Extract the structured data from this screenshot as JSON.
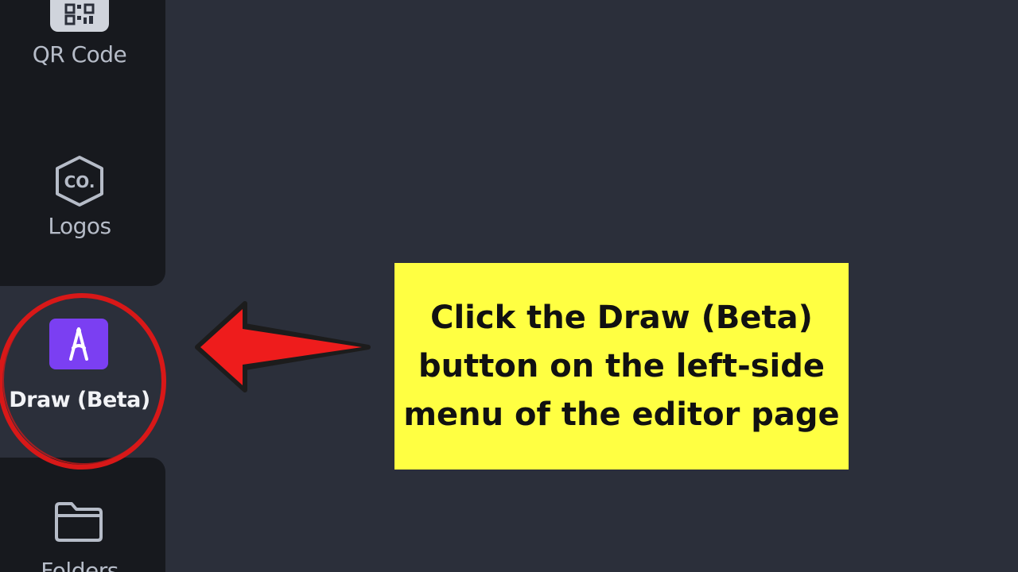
{
  "sidebar": {
    "items": [
      {
        "label": "QR Code",
        "icon": "qr-code-icon"
      },
      {
        "label": "Logos",
        "icon": "logo-hexagon-icon"
      },
      {
        "label": "Draw (Beta)",
        "icon": "draw-icon"
      },
      {
        "label": "Folders",
        "icon": "folder-icon"
      }
    ],
    "logos_icon_text": "CO."
  },
  "callout": {
    "lines": [
      "Click the Draw (Beta)",
      "button on the left-side",
      "menu of the editor page"
    ],
    "background": "#ffff42"
  },
  "colors": {
    "canvas": "#2b2f3a",
    "sidebar": "#17191e",
    "draw_accent": "#7b3ff2",
    "annotation_red": "#e01a1a"
  }
}
